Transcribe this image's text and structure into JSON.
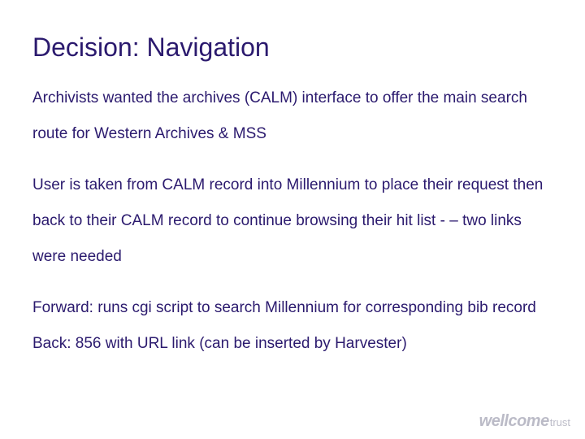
{
  "title": "Decision: Navigation",
  "paragraphs": {
    "p1": "Archivists wanted the archives (CALM) interface to offer the main search route for Western Archives & MSS",
    "p2": "User is taken from CALM record into Millennium to place their request then back to their CALM record to continue browsing their hit list  - – two links were needed",
    "p3": "Forward:  runs cgi script to search Millennium for corresponding bib record",
    "p4": "Back:  856 with URL link (can be inserted by Harvester)"
  },
  "logo": {
    "main": "wellcome",
    "sub": "trust"
  }
}
